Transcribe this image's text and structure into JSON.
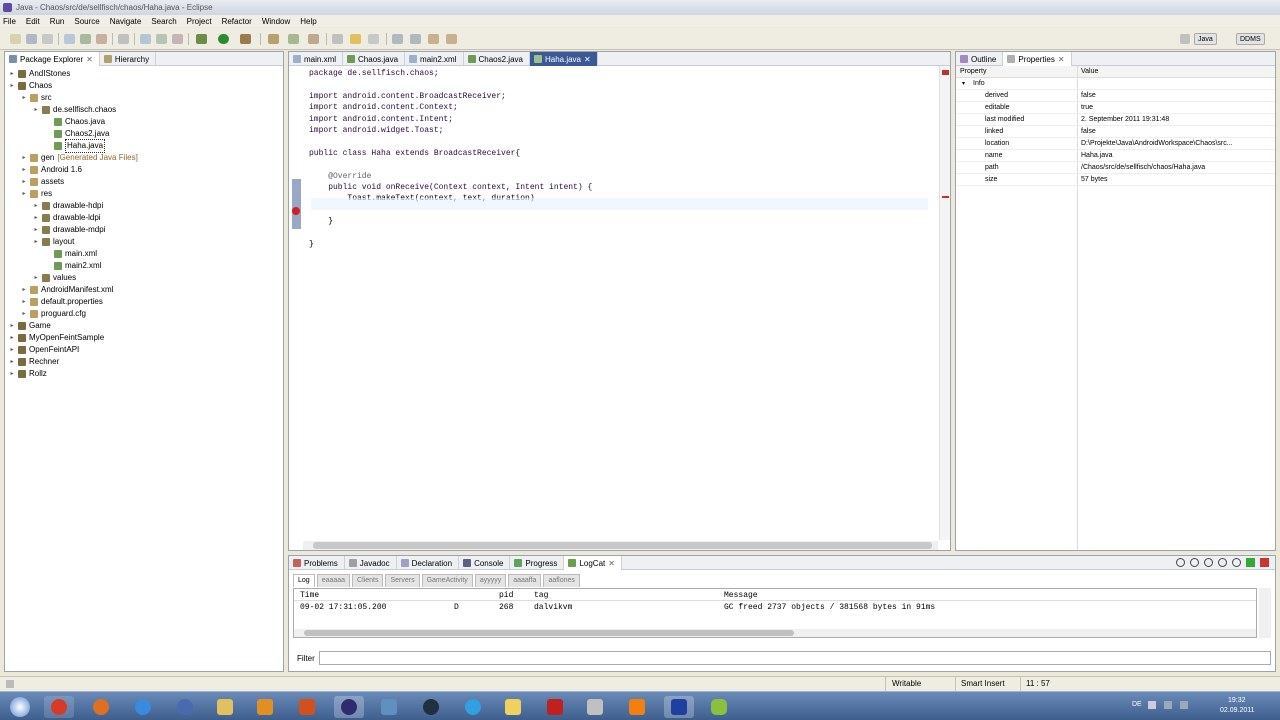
{
  "window": {
    "title": "Java - Chaos/src/de/sellfisch/chaos/Haha.java - Eclipse"
  },
  "menu": [
    "File",
    "Edit",
    "Run",
    "Source",
    "Navigate",
    "Search",
    "Project",
    "Refactor",
    "Window",
    "Help"
  ],
  "toolbar": {
    "perspectives": [
      "Java",
      "DDMS"
    ]
  },
  "package_explorer": {
    "tabs": [
      "Package Explorer",
      "Hierarchy"
    ],
    "tree": [
      {
        "label": "AndIStones",
        "level": 0
      },
      {
        "label": "Chaos",
        "level": 0
      },
      {
        "label": "src",
        "level": 1
      },
      {
        "label": "de.sellfisch.chaos",
        "level": 2
      },
      {
        "label": "Chaos.java",
        "level": 3
      },
      {
        "label": "Chaos2.java",
        "level": 3
      },
      {
        "label": "Haha.java",
        "level": 3
      },
      {
        "label": "gen",
        "level": 1,
        "suffix": "[Generated Java Files]"
      },
      {
        "label": "Android 1.6",
        "level": 1
      },
      {
        "label": "assets",
        "level": 1
      },
      {
        "label": "res",
        "level": 1
      },
      {
        "label": "drawable-hdpi",
        "level": 2
      },
      {
        "label": "drawable-ldpi",
        "level": 2
      },
      {
        "label": "drawable-mdpi",
        "level": 2
      },
      {
        "label": "layout",
        "level": 2
      },
      {
        "label": "main.xml",
        "level": 3
      },
      {
        "label": "main2.xml",
        "level": 3
      },
      {
        "label": "values",
        "level": 2
      },
      {
        "label": "AndroidManifest.xml",
        "level": 1
      },
      {
        "label": "default.properties",
        "level": 1
      },
      {
        "label": "proguard.cfg",
        "level": 1
      },
      {
        "label": "Game",
        "level": 0
      },
      {
        "label": "MyOpenFeintSample",
        "level": 0
      },
      {
        "label": "OpenFeintAPI",
        "level": 0
      },
      {
        "label": "Rechner",
        "level": 0
      },
      {
        "label": "Rollz",
        "level": 0
      }
    ]
  },
  "editor": {
    "tabs": [
      "main.xml",
      "Chaos.java",
      "main2.xml",
      "Chaos2.java",
      "Haha.java"
    ],
    "lines": [
      "package de.sellfisch.chaos;",
      "",
      "import android.content.BroadcastReceiver;",
      "import android.content.Context;",
      "import android.content.Intent;",
      "import android.widget.Toast;",
      "",
      "public class Haha extends BroadcastReceiver{",
      "",
      "    @Override",
      "    public void onReceive(Context context, Intent intent) {",
      "        Toast.makeText(context, text, duration)",
      "",
      "    }",
      "",
      "}"
    ]
  },
  "properties": {
    "tabs": [
      "Outline",
      "Properties"
    ],
    "headers": [
      "Property",
      "Value"
    ],
    "group": "Info",
    "rows": [
      {
        "key": "derived",
        "value": "false"
      },
      {
        "key": "editable",
        "value": "true"
      },
      {
        "key": "last modified",
        "value": "2. September 2011 19:31:48"
      },
      {
        "key": "linked",
        "value": "false"
      },
      {
        "key": "location",
        "value": "D:\\Projekte\\Java\\AndroidWorkspace\\Chaos\\src..."
      },
      {
        "key": "name",
        "value": "Haha.java"
      },
      {
        "key": "path",
        "value": "/Chaos/src/de/sellfisch/chaos/Haha.java"
      },
      {
        "key": "size",
        "value": "57  bytes"
      }
    ]
  },
  "bottom": {
    "tabs": [
      "Problems",
      "Javadoc",
      "Declaration",
      "Console",
      "Progress",
      "LogCat"
    ],
    "log_tabs": [
      "Log",
      "eaaaaa",
      "Clients",
      "Servers",
      "GameActivity",
      "ayyyyy",
      "aaaaffa",
      "aaflones"
    ],
    "columns": [
      "Time",
      "pid",
      "tag",
      "Message"
    ],
    "rows": [
      {
        "time": "09-02 17:31:05.200",
        "level": "D",
        "pid": "268",
        "tag": "dalvikvm",
        "message": "GC freed 2737 objects / 381568 bytes in 91ms"
      }
    ],
    "filter_label": "Filter"
  },
  "status": {
    "writable": "Writable",
    "insert": "Smart Insert",
    "position": "11 : 57"
  },
  "tray": {
    "lang": "DE",
    "time": "19:32",
    "date": "02.09.2011"
  }
}
